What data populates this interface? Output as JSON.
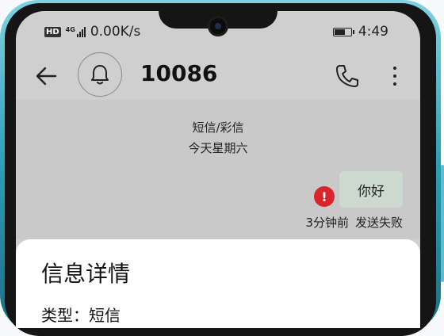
{
  "status_bar": {
    "hd": "HD",
    "network": "4G",
    "speed": "0.00K/s",
    "time": "4:49",
    "battery_level": 0.6
  },
  "header": {
    "back_icon": "arrow-left-icon",
    "bell_icon": "bell-icon",
    "title": "10086",
    "call_icon": "phone-icon",
    "more_icon": "more-vertical-icon"
  },
  "conversation": {
    "message_type": "短信/彩信",
    "day": "今天星期六",
    "bubble_text": "你好",
    "fail_icon": "exclamation-icon",
    "fail_symbol": "!",
    "time_ago": "3分钟前",
    "status": "发送失败"
  },
  "details": {
    "title": "信息详情",
    "type_label": "类型：",
    "type_value": "短信"
  },
  "colors": {
    "bubble": "#cbd9cf",
    "fail_red": "#d9242b",
    "frame": "#2a9fb4"
  }
}
